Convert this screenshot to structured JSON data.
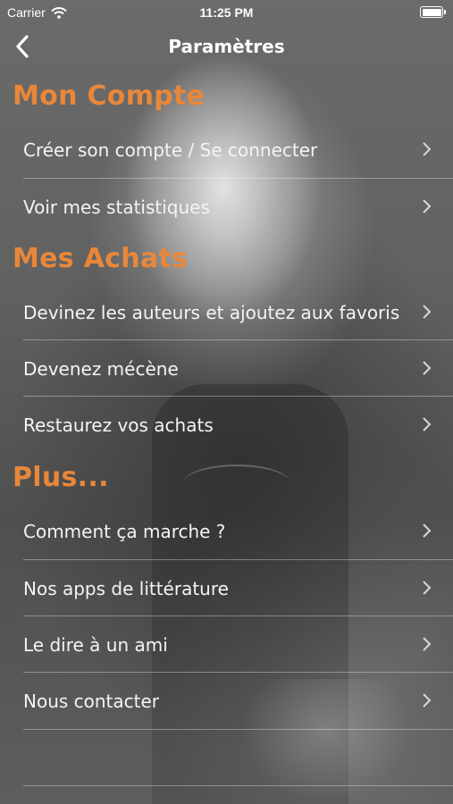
{
  "status_bar": {
    "carrier": "Carrier",
    "time": "11:25 PM"
  },
  "navbar": {
    "title": "Paramètres"
  },
  "sections": [
    {
      "title": "Mon Compte",
      "items": [
        {
          "label": "Créer son compte / Se connecter"
        },
        {
          "label": "Voir mes statistiques"
        }
      ]
    },
    {
      "title": "Mes Achats",
      "items": [
        {
          "label": "Devinez les auteurs et ajoutez aux favoris"
        },
        {
          "label": "Devenez mécène"
        },
        {
          "label": "Restaurez vos achats"
        }
      ]
    },
    {
      "title": "Plus...",
      "items": [
        {
          "label": "Comment ça marche ?"
        },
        {
          "label": "Nos apps de littérature"
        },
        {
          "label": "Le dire à un ami"
        },
        {
          "label": "Nous contacter"
        }
      ]
    }
  ],
  "colors": {
    "section_title": "#e8873a",
    "text": "#ffffff"
  }
}
